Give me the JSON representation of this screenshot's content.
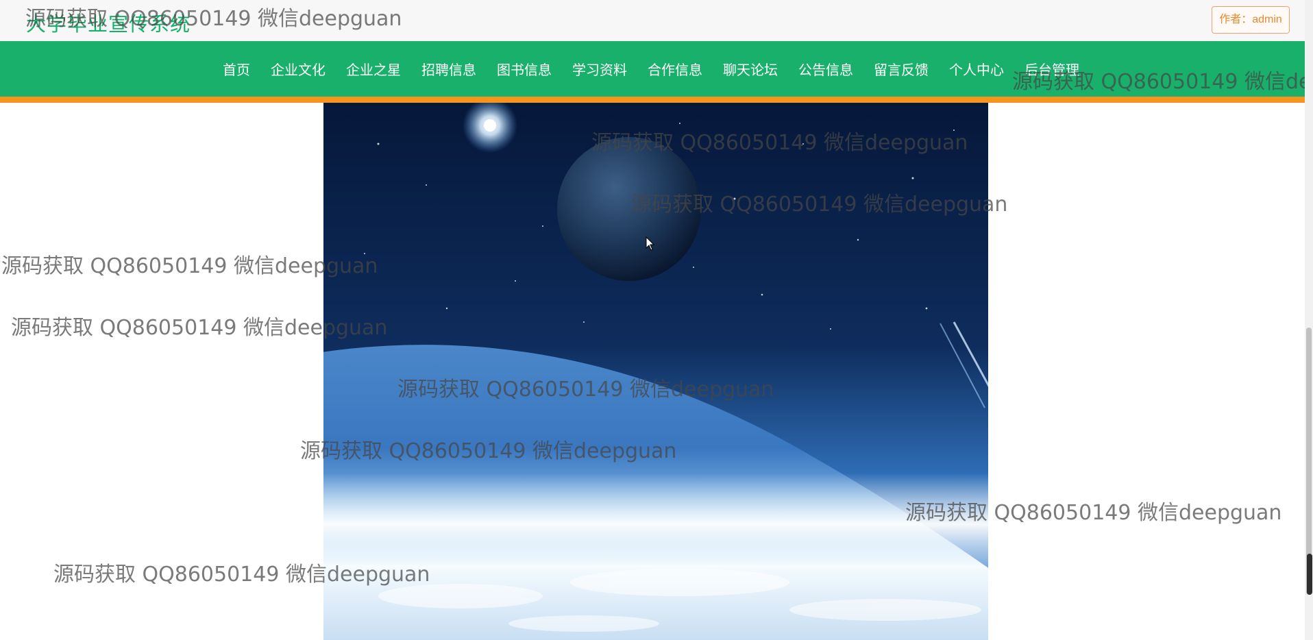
{
  "site": {
    "title": "大学毕业宣传系统",
    "author_badge": "作者：admin"
  },
  "nav": {
    "items": [
      {
        "label": "首页",
        "name": "nav-home"
      },
      {
        "label": "企业文化",
        "name": "nav-culture"
      },
      {
        "label": "企业之星",
        "name": "nav-stars"
      },
      {
        "label": "招聘信息",
        "name": "nav-recruit"
      },
      {
        "label": "图书信息",
        "name": "nav-books"
      },
      {
        "label": "学习资料",
        "name": "nav-materials"
      },
      {
        "label": "合作信息",
        "name": "nav-cooperation"
      },
      {
        "label": "聊天论坛",
        "name": "nav-forum"
      },
      {
        "label": "公告信息",
        "name": "nav-notice"
      },
      {
        "label": "留言反馈",
        "name": "nav-feedback"
      },
      {
        "label": "个人中心",
        "name": "nav-profile"
      },
      {
        "label": "后台管理",
        "name": "nav-admin"
      }
    ]
  },
  "watermark": {
    "text": "源码获取 QQ86050149 微信deepguan"
  },
  "hero": {
    "image_alt": "space-planet-banner"
  },
  "colors": {
    "brand_green": "#18b06b",
    "accent_orange": "#f7941d",
    "title_green": "#17b06a"
  }
}
